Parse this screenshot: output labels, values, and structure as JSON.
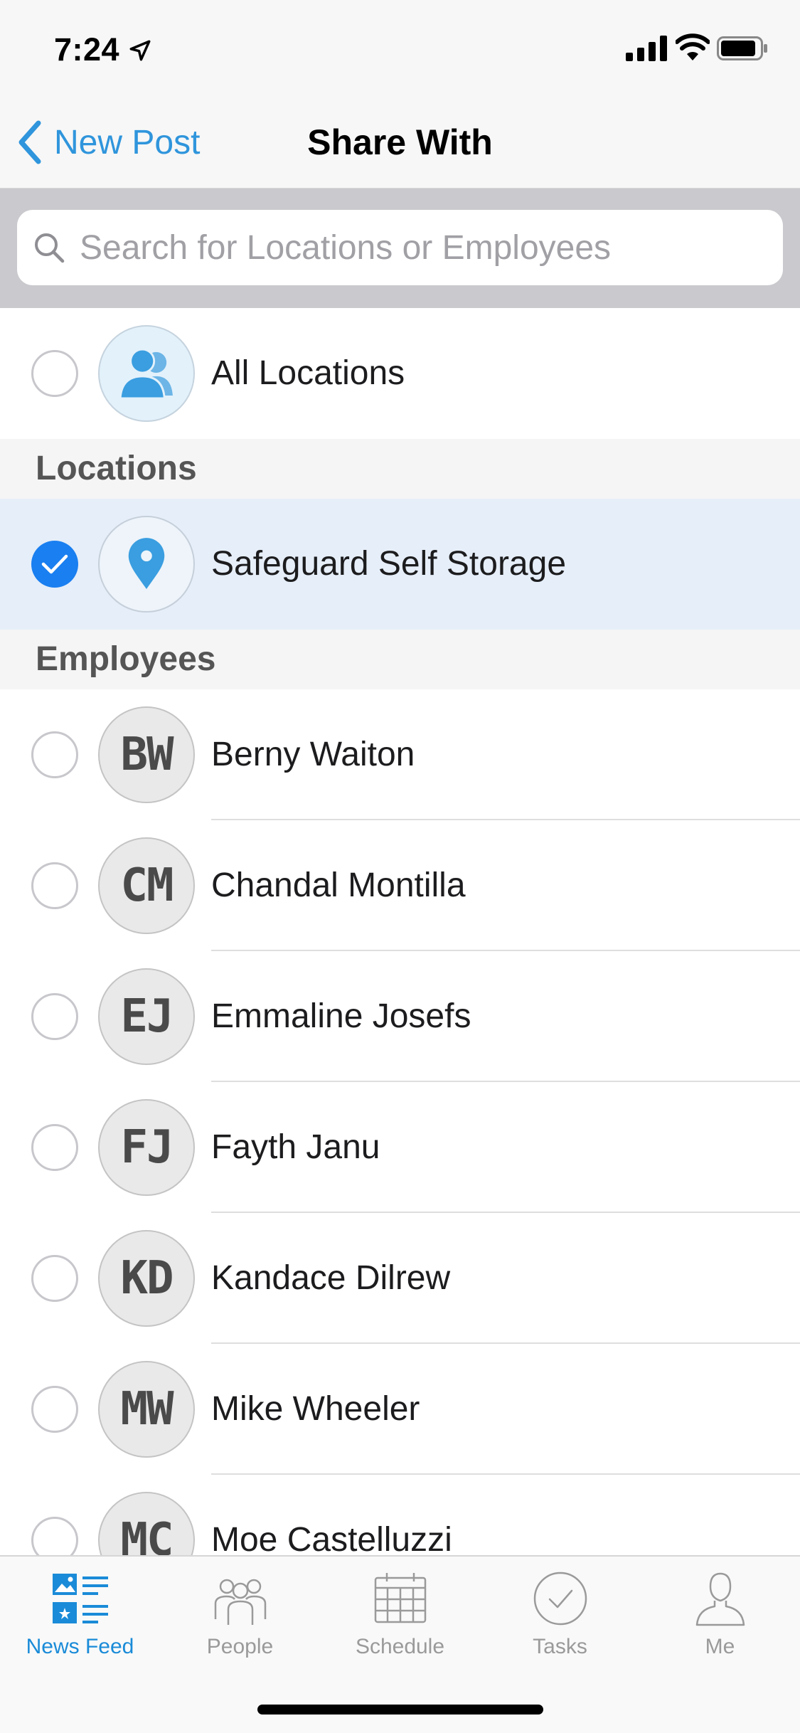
{
  "status_bar": {
    "time": "7:24"
  },
  "nav": {
    "back_label": "New Post",
    "title": "Share With"
  },
  "search": {
    "placeholder": "Search for Locations or Employees",
    "value": ""
  },
  "all_locations": {
    "label": "All Locations",
    "selected": false
  },
  "sections": {
    "locations": "Locations",
    "employees": "Employees"
  },
  "locations": [
    {
      "label": "Safeguard Self Storage",
      "selected": true
    }
  ],
  "employees": [
    {
      "initials": "BW",
      "name": "Berny Waiton",
      "selected": false
    },
    {
      "initials": "CM",
      "name": "Chandal Montilla",
      "selected": false
    },
    {
      "initials": "EJ",
      "name": "Emmaline Josefs",
      "selected": false
    },
    {
      "initials": "FJ",
      "name": "Fayth Janu",
      "selected": false
    },
    {
      "initials": "KD",
      "name": "Kandace Dilrew",
      "selected": false
    },
    {
      "initials": "MW",
      "name": "Mike Wheeler",
      "selected": false
    },
    {
      "initials": "MC",
      "name": "Moe Castelluzzi",
      "selected": false
    }
  ],
  "tabs": [
    {
      "label": "News Feed",
      "icon": "news-feed-icon",
      "active": true
    },
    {
      "label": "People",
      "icon": "people-icon",
      "active": false
    },
    {
      "label": "Schedule",
      "icon": "schedule-icon",
      "active": false
    },
    {
      "label": "Tasks",
      "icon": "tasks-icon",
      "active": false
    },
    {
      "label": "Me",
      "icon": "me-icon",
      "active": false
    }
  ],
  "colors": {
    "accent": "#1a7ff0",
    "link": "#2f95dc",
    "selected_row": "#e6eef9",
    "tab_active": "#1a8bd8"
  }
}
